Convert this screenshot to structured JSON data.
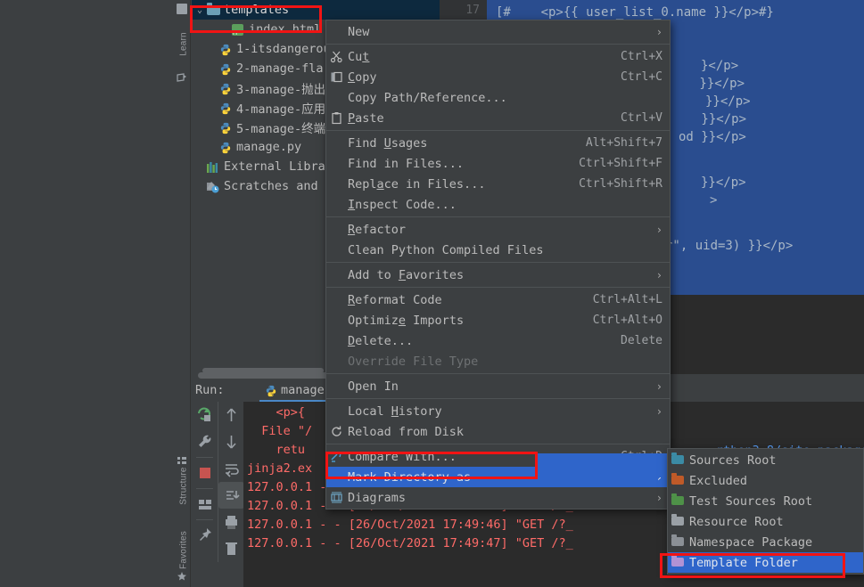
{
  "app": {
    "theme_bg": "#3c3f41",
    "editor_bg": "#2b2b2b",
    "accent_blue": "#2f65ca",
    "selection_blue": "#2a4d8f",
    "annotation_red": "#f11414"
  },
  "tool_strip": {
    "tabs": [
      {
        "label": "Learn",
        "icon": "learn-icon"
      },
      {
        "label": "Structure",
        "icon": "structure-icon"
      },
      {
        "label": "Favorites",
        "icon": "favorites-icon"
      }
    ]
  },
  "project_tree": {
    "rows": [
      {
        "label": "templates",
        "icon": "folder-icon",
        "indent": 0,
        "chevron": "v",
        "selected": true
      },
      {
        "label": "index.html",
        "icon": "html-file-icon",
        "indent": 2,
        "chevron": "",
        "selected": false
      },
      {
        "label": "1-itsdangerous",
        "icon": "python-file-icon",
        "indent": 1,
        "chevron": "",
        "selected": false
      },
      {
        "label": "2-manage-fla",
        "icon": "python-file-icon",
        "indent": 1,
        "chevron": "",
        "selected": false
      },
      {
        "label": "3-manage-抛出",
        "icon": "python-file-icon",
        "indent": 1,
        "chevron": "",
        "selected": false
      },
      {
        "label": "4-manage-应用",
        "icon": "python-file-icon",
        "indent": 1,
        "chevron": "",
        "selected": false
      },
      {
        "label": "5-manage-终端",
        "icon": "python-file-icon",
        "indent": 1,
        "chevron": "",
        "selected": false
      },
      {
        "label": "manage.py",
        "icon": "python-file-icon",
        "indent": 1,
        "chevron": "",
        "selected": false
      },
      {
        "label": "External Libra",
        "icon": "external-libraries-icon",
        "indent": 0,
        "chevron": "",
        "selected": false
      },
      {
        "label": "Scratches and",
        "icon": "scratches-icon",
        "indent": 0,
        "chevron": "",
        "selected": false
      }
    ]
  },
  "editor": {
    "line_numbers": [
      "17"
    ],
    "lines": [
      "[#    <p>{{ user_list_0.name }}</p>#}",
      "",
      "}</p>",
      " }}</p>",
      "}}</p>",
      " }}</p>",
      "od }}</p>",
      "",
      "}}</p>",
      ">",
      "",
      "r\", uid=3) }}</p>"
    ]
  },
  "context_menu": {
    "items": [
      {
        "label": "New",
        "accel": "",
        "icon": "",
        "submenu": true,
        "sep_after": true,
        "disabled": false,
        "highlighted": false,
        "mnemonic": -1
      },
      {
        "label": "Cut",
        "accel": "Ctrl+X",
        "icon": "scissors-icon",
        "submenu": false,
        "sep_after": false,
        "disabled": false,
        "highlighted": false,
        "mnemonic": 2
      },
      {
        "label": "Copy",
        "accel": "Ctrl+C",
        "icon": "copy-icon",
        "submenu": false,
        "sep_after": false,
        "disabled": false,
        "highlighted": false,
        "mnemonic": 0
      },
      {
        "label": "Copy Path/Reference...",
        "accel": "",
        "icon": "",
        "submenu": false,
        "sep_after": false,
        "disabled": false,
        "highlighted": false,
        "mnemonic": -1
      },
      {
        "label": "Paste",
        "accel": "Ctrl+V",
        "icon": "paste-icon",
        "submenu": false,
        "sep_after": true,
        "disabled": false,
        "highlighted": false,
        "mnemonic": 0
      },
      {
        "label": "Find Usages",
        "accel": "Alt+Shift+7",
        "icon": "",
        "submenu": false,
        "sep_after": false,
        "disabled": false,
        "highlighted": false,
        "mnemonic": 5
      },
      {
        "label": "Find in Files...",
        "accel": "Ctrl+Shift+F",
        "icon": "",
        "submenu": false,
        "sep_after": false,
        "disabled": false,
        "highlighted": false,
        "mnemonic": -1
      },
      {
        "label": "Replace in Files...",
        "accel": "Ctrl+Shift+R",
        "icon": "",
        "submenu": false,
        "sep_after": false,
        "disabled": false,
        "highlighted": false,
        "mnemonic": 4
      },
      {
        "label": "Inspect Code...",
        "accel": "",
        "icon": "",
        "submenu": false,
        "sep_after": true,
        "disabled": false,
        "highlighted": false,
        "mnemonic": 0
      },
      {
        "label": "Refactor",
        "accel": "",
        "icon": "",
        "submenu": true,
        "sep_after": false,
        "disabled": false,
        "highlighted": false,
        "mnemonic": 0
      },
      {
        "label": "Clean Python Compiled Files",
        "accel": "",
        "icon": "",
        "submenu": false,
        "sep_after": true,
        "disabled": false,
        "highlighted": false,
        "mnemonic": -1
      },
      {
        "label": "Add to Favorites",
        "accel": "",
        "icon": "",
        "submenu": true,
        "sep_after": true,
        "disabled": false,
        "highlighted": false,
        "mnemonic": 7
      },
      {
        "label": "Reformat Code",
        "accel": "Ctrl+Alt+L",
        "icon": "",
        "submenu": false,
        "sep_after": false,
        "disabled": false,
        "highlighted": false,
        "mnemonic": 0
      },
      {
        "label": "Optimize Imports",
        "accel": "Ctrl+Alt+O",
        "icon": "",
        "submenu": false,
        "sep_after": false,
        "disabled": false,
        "highlighted": false,
        "mnemonic": 7
      },
      {
        "label": "Delete...",
        "accel": "Delete",
        "icon": "",
        "submenu": false,
        "sep_after": false,
        "disabled": false,
        "highlighted": false,
        "mnemonic": 0
      },
      {
        "label": "Override File Type",
        "accel": "",
        "icon": "",
        "submenu": false,
        "sep_after": true,
        "disabled": true,
        "highlighted": false,
        "mnemonic": -1
      },
      {
        "label": "Open In",
        "accel": "",
        "icon": "",
        "submenu": true,
        "sep_after": true,
        "disabled": false,
        "highlighted": false,
        "mnemonic": -1
      },
      {
        "label": "Local History",
        "accel": "",
        "icon": "",
        "submenu": true,
        "sep_after": false,
        "disabled": false,
        "highlighted": false,
        "mnemonic": 6
      },
      {
        "label": "Reload from Disk",
        "accel": "",
        "icon": "reload-icon",
        "submenu": false,
        "sep_after": true,
        "disabled": false,
        "highlighted": false,
        "mnemonic": -1
      },
      {
        "label": "Compare With...",
        "accel": "Ctrl+D",
        "icon": "compare-icon",
        "submenu": false,
        "sep_after": false,
        "disabled": false,
        "highlighted": false,
        "mnemonic": -1
      },
      {
        "label": "Mark Directory as",
        "accel": "",
        "icon": "",
        "submenu": true,
        "sep_after": false,
        "disabled": false,
        "highlighted": true,
        "mnemonic": -1
      },
      {
        "label": "Diagrams",
        "accel": "",
        "icon": "diagrams-icon",
        "submenu": true,
        "sep_after": false,
        "disabled": false,
        "highlighted": false,
        "mnemonic": -1
      }
    ]
  },
  "submenu_mark_directory": {
    "items": [
      {
        "label": "Sources Root",
        "folder_color": "#3b8ba5",
        "highlighted": false
      },
      {
        "label": "Excluded",
        "folder_color": "#bf5a28",
        "highlighted": false
      },
      {
        "label": "Test Sources Root",
        "folder_color": "#4e9148",
        "highlighted": false
      },
      {
        "label": "Resource Root",
        "folder_color": "#9aa0a6",
        "highlighted": false
      },
      {
        "label": "Namespace Package",
        "folder_color": "#8b9096",
        "highlighted": false
      },
      {
        "label": "Template Folder",
        "folder_color": "#b292d4",
        "highlighted": true
      }
    ]
  },
  "run_panel": {
    "title": "Run:",
    "tab_label": "manage",
    "tab_icon": "python-icon",
    "close_label": "›",
    "left_tools": [
      {
        "name": "rerun-icon"
      },
      {
        "name": "wrench-settings-icon"
      },
      {
        "name": "stop-icon"
      },
      {
        "name": "layout-icon"
      },
      {
        "name": "pin-icon"
      }
    ],
    "right_tools": [
      {
        "name": "up-arrow-icon"
      },
      {
        "name": "down-arrow-icon"
      },
      {
        "name": "soft-wrap-icon"
      },
      {
        "name": "scroll-to-end-icon"
      },
      {
        "name": "print-icon"
      },
      {
        "name": "trash-icon"
      }
    ],
    "console_lines": [
      {
        "text": "    <p>{",
        "link": ""
      },
      {
        "text": "  File \"/",
        "link": ""
      },
      {
        "text": "    retu",
        "link": ""
      },
      {
        "text": "jinja2.ex",
        "link": ""
      },
      {
        "text": "127.0.0.1 - - [26/Oct/2021 17:49:46] \"GET /?_",
        "link": ""
      },
      {
        "text": "127.0.0.1 - - [26/Oct/2021 17:49:46] \"GET /?_",
        "link": ""
      },
      {
        "text": "127.0.0.1 - - [26/Oct/2021 17:49:46] \"GET /?_",
        "link": ""
      },
      {
        "text": "127.0.0.1 - - [26/Oct/2021 17:49:47] \"GET /?_",
        "link": ""
      }
    ],
    "console_link": "rthon3.8/site-packages"
  }
}
